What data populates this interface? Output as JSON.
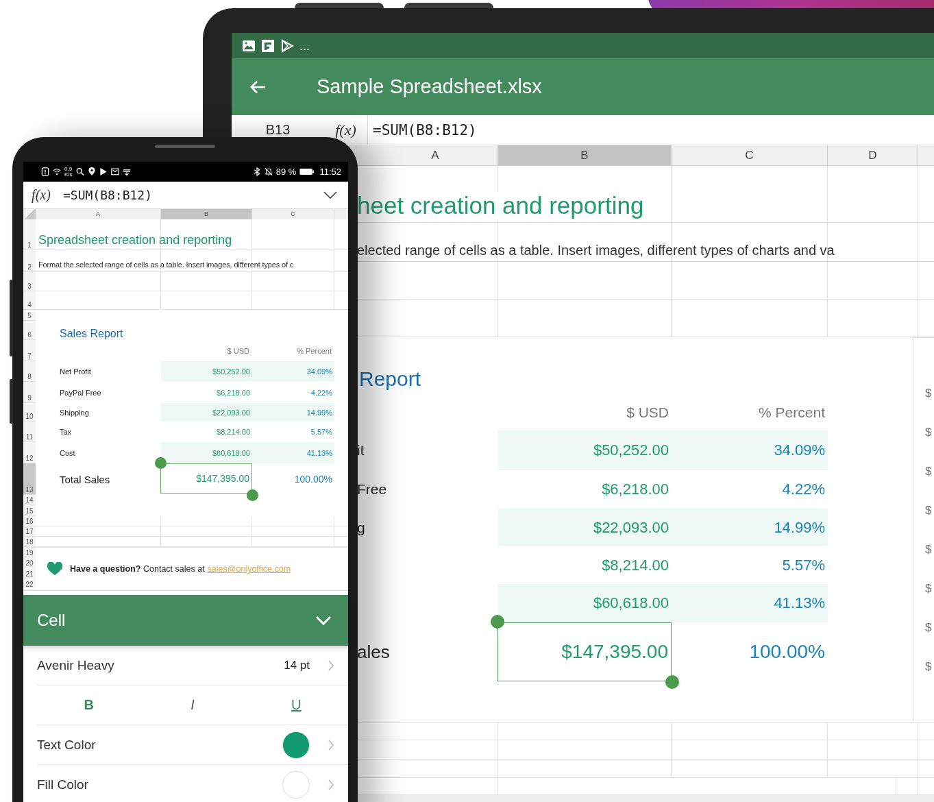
{
  "tablet": {
    "status_bar": {
      "overflow": "..."
    },
    "toolbar": {
      "title": "Sample Spreadsheet.xlsx"
    },
    "formula_bar": {
      "cell_ref": "B13",
      "function_label": "f(x)",
      "formula": "=SUM(B8:B12)"
    },
    "columns": [
      {
        "label": "A",
        "selected": false
      },
      {
        "label": "B",
        "selected": true
      },
      {
        "label": "C",
        "selected": false
      },
      {
        "label": "D",
        "selected": false
      }
    ],
    "title": "heet creation and reporting",
    "subtitle": "elected range of cells as a table. Insert images, different types of charts and va",
    "report": {
      "title": "Report",
      "headers": [
        "$ USD",
        "% Percent"
      ],
      "lines": [
        {
          "label": "it",
          "usd": "$50,252.00",
          "percent": "34.09%"
        },
        {
          "label": "Free",
          "usd": "$6,218.00",
          "percent": "4.22%"
        },
        {
          "label": "g",
          "usd": "$22,093.00",
          "percent": "14.99%"
        },
        {
          "usd": "$8,214.00",
          "percent": "5.57%"
        },
        {
          "usd": "$60,618.00",
          "percent": "41.13%"
        }
      ],
      "total": {
        "label": "ales",
        "usd": "$147,395.00",
        "percent": "100.00%",
        "selected": true
      }
    },
    "chart_axis_labels": [
      "$",
      "$",
      "$",
      "$",
      "$",
      "$",
      "$",
      "$"
    ]
  },
  "phone": {
    "status_bar": {
      "speed_value": "0,9",
      "speed_unit": "K/s",
      "battery": "89 %",
      "time": "11:52"
    },
    "formula_bar": {
      "function_label": "f(x)",
      "formula": "=SUM(B8:B12)"
    },
    "columns": [
      {
        "label": "A",
        "selected": false
      },
      {
        "label": "B",
        "selected": true
      },
      {
        "label": "C",
        "selected": false
      }
    ],
    "rows": [
      {
        "number": "1",
        "kind": "title",
        "selected": false,
        "text": "Spreadsheet creation and reporting"
      },
      {
        "number": "2",
        "kind": "text",
        "selected": false,
        "text": "Format the selected range of cells as a table. Insert images, different types of c"
      },
      {
        "number": "3",
        "kind": "empty",
        "selected": false
      },
      {
        "number": "4",
        "kind": "empty",
        "selected": false
      },
      {
        "number": "5",
        "kind": "blank",
        "selected": false
      },
      {
        "number": "6",
        "kind": "report-title",
        "selected": false,
        "text": "Sales Report"
      },
      {
        "number": "7",
        "kind": "header",
        "selected": false,
        "usd": "$ USD",
        "percent": "% Percent"
      },
      {
        "number": "8",
        "kind": "line",
        "selected": false,
        "label": "Net Profit",
        "usd": "$50,252.00",
        "percent": "34.09%"
      },
      {
        "number": "9",
        "kind": "line",
        "selected": false,
        "label": "PayPal Free",
        "usd": "$6,218.00",
        "percent": "4.22%"
      },
      {
        "number": "10",
        "kind": "line",
        "selected": false,
        "label": "Shipping",
        "usd": "$22,093.00",
        "percent": "14.99%"
      },
      {
        "number": "11",
        "kind": "line",
        "selected": false,
        "label": "Tax",
        "usd": "$8,214.00",
        "percent": "5.57%"
      },
      {
        "number": "12",
        "kind": "line",
        "selected": false,
        "label": "Cost",
        "usd": "$60,618.00",
        "percent": "41.13%"
      },
      {
        "number": "13",
        "kind": "total",
        "selected": true,
        "label": "Total Sales",
        "usd": "$147,395.00",
        "percent": "100.00%"
      },
      {
        "number": "14",
        "kind": "blank",
        "selected": false
      },
      {
        "number": "15",
        "kind": "blank",
        "selected": false
      },
      {
        "number": "16",
        "kind": "empty",
        "selected": false
      },
      {
        "number": "17",
        "kind": "empty",
        "selected": false
      },
      {
        "number": "18",
        "kind": "empty",
        "selected": false
      }
    ],
    "banner": {
      "row_numbers": [
        "19",
        "20",
        "21",
        "22"
      ],
      "text": "**Have a question?** Contact sales at",
      "link": "sales@onlyoffice.com"
    },
    "cell_panel": {
      "title": "Cell",
      "font": {
        "name": "Avenir Heavy",
        "size": "14 pt"
      },
      "styles": [
        {
          "label": "B",
          "kind": "bold"
        },
        {
          "label": "I",
          "kind": "italic"
        },
        {
          "label": "U",
          "kind": "underline"
        }
      ],
      "colors": [
        {
          "label": "Text Color",
          "color": "#109a6e"
        },
        {
          "label": "Fill Color",
          "color": "#ffffff"
        }
      ]
    }
  }
}
